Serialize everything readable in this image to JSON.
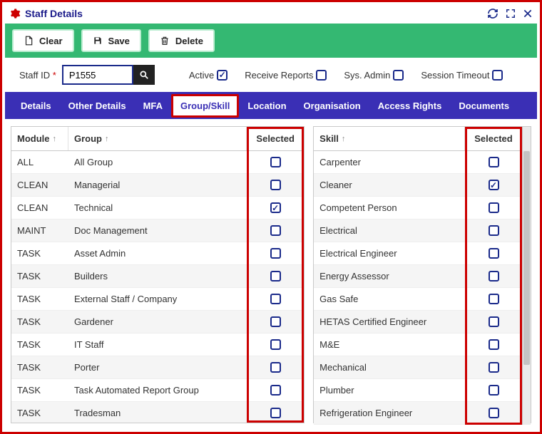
{
  "header": {
    "title": "Staff Details"
  },
  "toolbar": {
    "clear": "Clear",
    "save": "Save",
    "delete": "Delete"
  },
  "filters": {
    "staff_id_label": "Staff ID",
    "staff_id_value": "P1555",
    "active_label": "Active",
    "active_checked": true,
    "receive_reports_label": "Receive Reports",
    "receive_reports_checked": false,
    "sys_admin_label": "Sys. Admin",
    "sys_admin_checked": false,
    "session_timeout_label": "Session Timeout",
    "session_timeout_checked": false
  },
  "tabs": [
    {
      "label": "Details",
      "active": false
    },
    {
      "label": "Other Details",
      "active": false
    },
    {
      "label": "MFA",
      "active": false
    },
    {
      "label": "Group/Skill",
      "active": true
    },
    {
      "label": "Location",
      "active": false
    },
    {
      "label": "Organisation",
      "active": false
    },
    {
      "label": "Access Rights",
      "active": false
    },
    {
      "label": "Documents",
      "active": false
    }
  ],
  "group_table": {
    "columns": {
      "module": "Module",
      "group": "Group",
      "selected": "Selected"
    },
    "rows": [
      {
        "module": "ALL",
        "group": "All Group",
        "selected": false
      },
      {
        "module": "CLEAN",
        "group": "Managerial",
        "selected": false
      },
      {
        "module": "CLEAN",
        "group": "Technical",
        "selected": true
      },
      {
        "module": "MAINT",
        "group": "Doc Management",
        "selected": false
      },
      {
        "module": "TASK",
        "group": "Asset Admin",
        "selected": false
      },
      {
        "module": "TASK",
        "group": "Builders",
        "selected": false
      },
      {
        "module": "TASK",
        "group": "External Staff / Company",
        "selected": false
      },
      {
        "module": "TASK",
        "group": "Gardener",
        "selected": false
      },
      {
        "module": "TASK",
        "group": "IT Staff",
        "selected": false
      },
      {
        "module": "TASK",
        "group": "Porter",
        "selected": false
      },
      {
        "module": "TASK",
        "group": "Task Automated Report Group",
        "selected": false
      },
      {
        "module": "TASK",
        "group": "Tradesman",
        "selected": false
      }
    ]
  },
  "skill_table": {
    "columns": {
      "skill": "Skill",
      "selected": "Selected"
    },
    "rows": [
      {
        "skill": "Carpenter",
        "selected": false
      },
      {
        "skill": "Cleaner",
        "selected": true
      },
      {
        "skill": "Competent Person",
        "selected": false
      },
      {
        "skill": "Electrical",
        "selected": false
      },
      {
        "skill": "Electrical Engineer",
        "selected": false
      },
      {
        "skill": "Energy Assessor",
        "selected": false
      },
      {
        "skill": "Gas Safe",
        "selected": false
      },
      {
        "skill": "HETAS Certified Engineer",
        "selected": false
      },
      {
        "skill": "M&E",
        "selected": false
      },
      {
        "skill": "Mechanical",
        "selected": false
      },
      {
        "skill": "Plumber",
        "selected": false
      },
      {
        "skill": "Refrigeration Engineer",
        "selected": false
      }
    ]
  }
}
